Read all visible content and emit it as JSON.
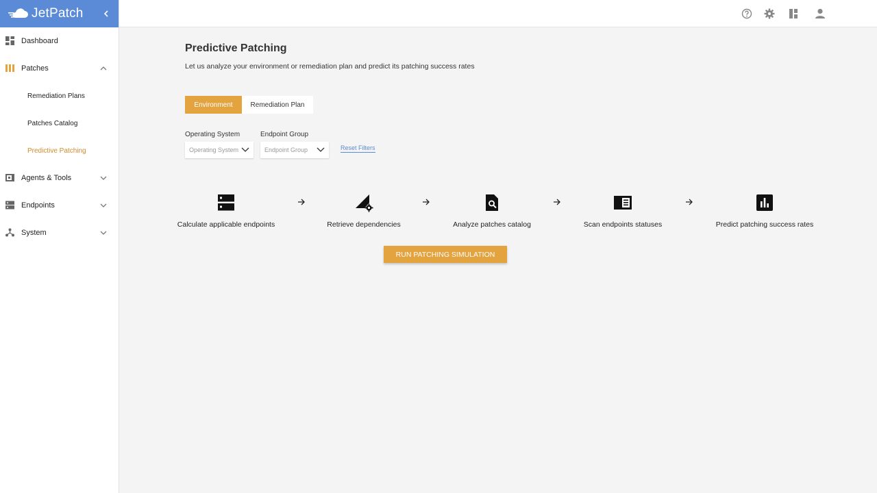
{
  "brand": {
    "name": "JetPatch",
    "logo_icon": "cloud-logo-icon",
    "collapse_icon": "chevron-left-icon"
  },
  "sidebar": {
    "items": [
      {
        "label": "Dashboard",
        "icon": "dashboard-icon"
      },
      {
        "label": "Patches",
        "icon": "patches-icon",
        "expanded": true,
        "children": [
          {
            "label": "Remediation Plans"
          },
          {
            "label": "Patches Catalog"
          },
          {
            "label": "Predictive Patching",
            "active": true
          }
        ]
      },
      {
        "label": "Agents & Tools",
        "icon": "agents-icon",
        "expanded": false
      },
      {
        "label": "Endpoints",
        "icon": "endpoints-icon",
        "expanded": false
      },
      {
        "label": "System",
        "icon": "system-icon",
        "expanded": false
      }
    ]
  },
  "topbar": {
    "icons": [
      "help-icon",
      "gear-icon",
      "columns-icon",
      "user-icon"
    ]
  },
  "main": {
    "title": "Predictive Patching",
    "subtitle": "Let us analyze your environment or remediation plan and predict its patching success rates",
    "tabs": [
      {
        "label": "Environment",
        "active": true
      },
      {
        "label": "Remediation Plan",
        "active": false
      }
    ],
    "filters": {
      "os": {
        "label": "Operating System",
        "placeholder": "Operating System"
      },
      "group": {
        "label": "Endpoint Group",
        "placeholder": "Endpoint Group"
      },
      "reset": "Reset Filters"
    },
    "steps": [
      {
        "label": "Calculate applicable endpoints",
        "icon": "server-icon"
      },
      {
        "label": "Retrieve dependencies",
        "icon": "signal-settings-icon"
      },
      {
        "label": "Analyze patches catalog",
        "icon": "search-file-icon"
      },
      {
        "label": "Scan endpoints statuses",
        "icon": "chrome-reader-icon"
      },
      {
        "label": "Predict patching success rates",
        "icon": "bar-chart-icon"
      }
    ],
    "run_button": "RUN PATCHING SIMULATION"
  },
  "colors": {
    "brand_blue": "#5b8ad6",
    "accent_orange": "#e3a33e",
    "active_link": "#d18a2d"
  }
}
